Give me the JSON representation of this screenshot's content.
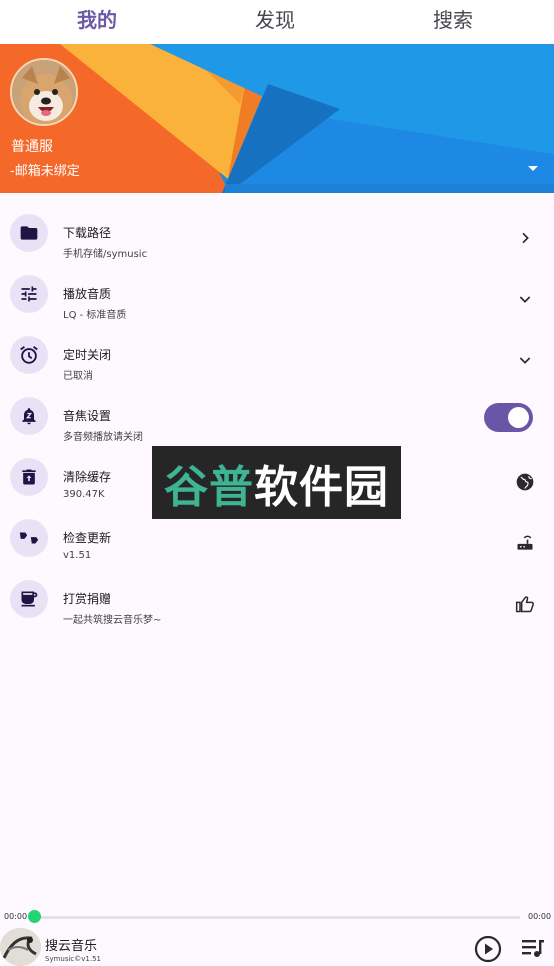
{
  "tabs": [
    {
      "label": "我的",
      "active": true
    },
    {
      "label": "发现",
      "active": false
    },
    {
      "label": "搜索",
      "active": false
    }
  ],
  "profile": {
    "username": "普通服",
    "email": "-邮箱未绑定"
  },
  "settings": [
    {
      "title": "下载路径",
      "subtitle": "手机存储/symusic",
      "icon": "folder-icon",
      "trailing": "chevron-right-icon"
    },
    {
      "title": "播放音质",
      "subtitle": "LQ - 标准音质",
      "icon": "tune-icon",
      "trailing": "chevron-down-icon"
    },
    {
      "title": "定时关闭",
      "subtitle": "已取消",
      "icon": "alarm-icon",
      "trailing": "chevron-down-icon"
    },
    {
      "title": "音焦设置",
      "subtitle": "多音频播放请关闭",
      "icon": "notification-z-icon",
      "trailing": "toggle",
      "toggle_on": true
    },
    {
      "title": "清除缓存",
      "subtitle": "390.47K",
      "icon": "trash-icon",
      "trailing": "globe-icon"
    },
    {
      "title": "检查更新",
      "subtitle": "v1.51",
      "icon": "quote-icon",
      "trailing": "router-icon"
    },
    {
      "title": "打赏捐赠",
      "subtitle": "一起共筑搜云音乐梦~",
      "icon": "coffee-icon",
      "trailing": "thumb-up-icon"
    }
  ],
  "watermark": {
    "part1": "谷普",
    "part2": "软件园"
  },
  "player": {
    "time_current": "00:00",
    "time_total": "00:00",
    "progress": 0,
    "title": "搜云音乐",
    "subtitle": "Symusic©v1.51"
  },
  "colors": {
    "accent": "#6a55a7",
    "icon_bg": "#e9e1f6",
    "progress_thumb": "#21d474"
  }
}
